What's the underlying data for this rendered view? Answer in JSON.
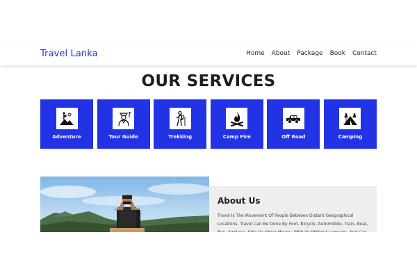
{
  "header": {
    "brand": "Travel Lanka",
    "nav": [
      {
        "label": "Home"
      },
      {
        "label": "About"
      },
      {
        "label": "Package"
      },
      {
        "label": "Book"
      },
      {
        "label": "Contact"
      }
    ]
  },
  "services": {
    "title": "OUR SERVICES",
    "items": [
      {
        "label": "Adventure",
        "icon": "mountain-hiker-icon"
      },
      {
        "label": "Tour Guide",
        "icon": "tour-guide-icon"
      },
      {
        "label": "Trekking",
        "icon": "trekking-icon"
      },
      {
        "label": "Camp Fire",
        "icon": "campfire-icon"
      },
      {
        "label": "Off Road",
        "icon": "jeep-icon"
      },
      {
        "label": "Camping",
        "icon": "tent-icon"
      }
    ]
  },
  "about": {
    "title": "About Us",
    "text": "Travel Is The Movement Of People Between Distant Geographical Locations. Travel Can Be Done By Foot, Bicycle, Automobile, Train, Boat, Bus, Airplane, Ship Or Other Means, With Or Without Luggage, And Can Be"
  },
  "colors": {
    "accent": "#2233e6",
    "brand": "#2233d9",
    "panel": "#eeeeee"
  }
}
